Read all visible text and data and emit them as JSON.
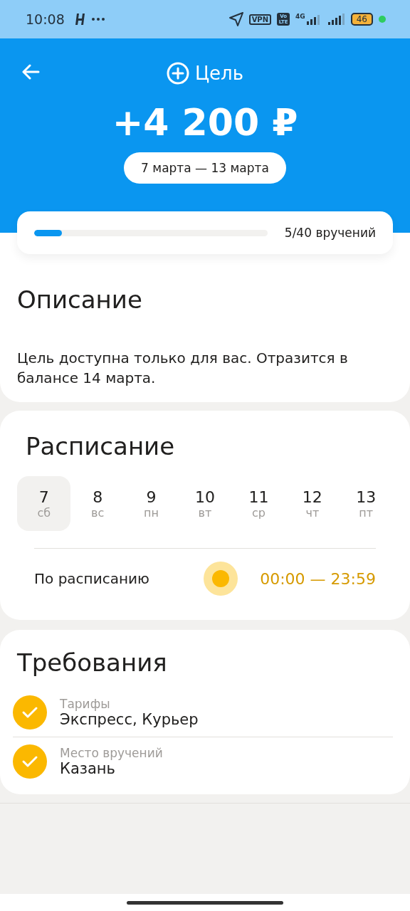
{
  "status_bar": {
    "time": "10:08",
    "vpn": "VPN",
    "volte": "Vo LTE",
    "network": "4G",
    "battery": "46"
  },
  "header": {
    "title": "Цель",
    "amount": "+4 200 ₽",
    "period": "7 марта — 13 марта"
  },
  "progress": {
    "level": 0.12,
    "reading": "5/40 вручений"
  },
  "description": {
    "title": "Описание",
    "text": "Цель доступна только для вас. Отразится в балансе 14 марта."
  },
  "schedule": {
    "title": "Расписание",
    "days": [
      {
        "date": "7",
        "weekday": "сб",
        "selected": true
      },
      {
        "date": "8",
        "weekday": "вс",
        "selected": false
      },
      {
        "date": "9",
        "weekday": "пн",
        "selected": false
      },
      {
        "date": "10",
        "weekday": "вт",
        "selected": false
      },
      {
        "date": "11",
        "weekday": "ср",
        "selected": false
      },
      {
        "date": "12",
        "weekday": "чт",
        "selected": false
      },
      {
        "date": "13",
        "weekday": "пт",
        "selected": false
      }
    ],
    "label": "По расписанию",
    "time": "00:00 — 23:59"
  },
  "requirements": {
    "title": "Требования",
    "items": [
      {
        "label": "Тарифы",
        "value": "Экспресс, Курьер",
        "checked": true
      },
      {
        "label": "Место вручений",
        "value": "Казань",
        "checked": true
      }
    ]
  }
}
